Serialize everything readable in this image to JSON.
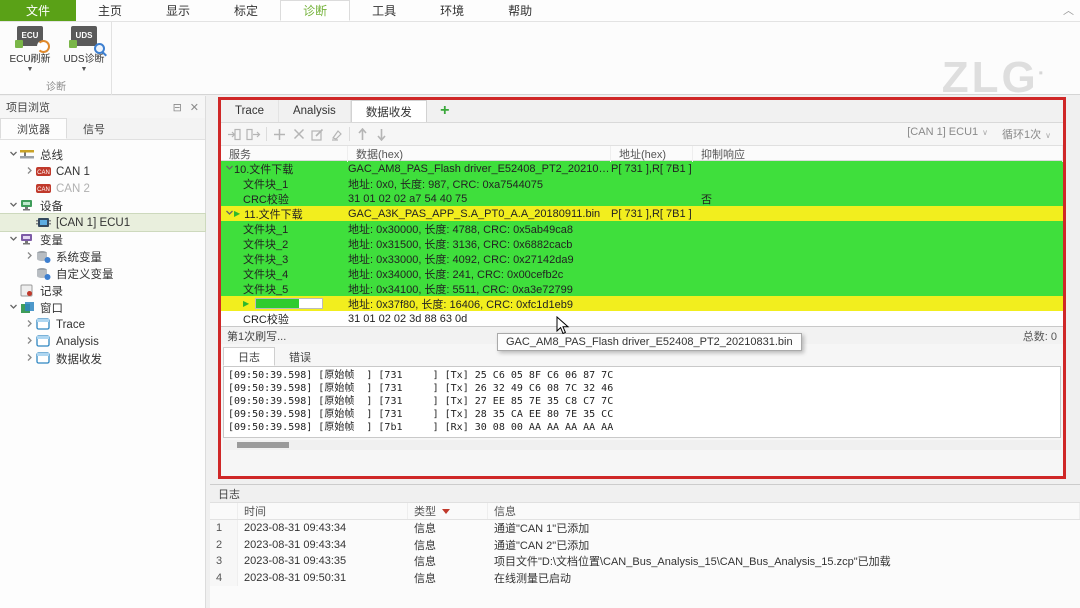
{
  "colors": {
    "row_green": "#3fdf3c",
    "row_yellow": "#f2ee1e",
    "annotation_red": "#cf2727",
    "accent_green": "#5aa117",
    "progress_green": "#2ecc2e"
  },
  "ribbon": {
    "tabs": [
      {
        "label": "文件",
        "accent": true
      },
      {
        "label": "主页"
      },
      {
        "label": "显示"
      },
      {
        "label": "标定"
      },
      {
        "label": "诊断",
        "active": true
      },
      {
        "label": "工具"
      },
      {
        "label": "环境"
      },
      {
        "label": "帮助"
      }
    ],
    "buttons": [
      {
        "label": "ECU刷新",
        "chip": "ECU",
        "overlay": "refresh",
        "caret": "▼"
      },
      {
        "label": "UDS诊断",
        "chip": "UDS",
        "overlay": "search",
        "caret": "▼"
      }
    ],
    "group_label": "诊断",
    "logo_text": "ZLG",
    "collapse_glyph": "︿"
  },
  "sidebar": {
    "title": "项目浏览",
    "pin_glyph": "⊟",
    "close_glyph": "✕",
    "tabs": [
      {
        "label": "浏览器",
        "active": true
      },
      {
        "label": "信号",
        "active": false
      }
    ],
    "tree": [
      {
        "label": "总线",
        "level": 0,
        "chev": "down",
        "icon": "bus"
      },
      {
        "label": "CAN 1",
        "level": 1,
        "chev": "right",
        "icon": "can"
      },
      {
        "label": "CAN 2",
        "level": 1,
        "chev": "",
        "icon": "can",
        "disabled": true
      },
      {
        "label": "设备",
        "level": 0,
        "chev": "down",
        "icon": "device"
      },
      {
        "label": "[CAN 1] ECU1",
        "level": 1,
        "chev": "",
        "icon": "ecu",
        "selected": true
      },
      {
        "label": "变量",
        "level": 0,
        "chev": "down",
        "icon": "variable"
      },
      {
        "label": "系统变量",
        "level": 1,
        "chev": "right",
        "icon": "sysvar"
      },
      {
        "label": "自定义变量",
        "level": 1,
        "chev": "",
        "icon": "uservar"
      },
      {
        "label": "记录",
        "level": 0,
        "chev": "",
        "icon": "record"
      },
      {
        "label": "窗口",
        "level": 0,
        "chev": "down",
        "icon": "winfolder"
      },
      {
        "label": "Trace",
        "level": 1,
        "chev": "right",
        "icon": "win"
      },
      {
        "label": "Analysis",
        "level": 1,
        "chev": "right",
        "icon": "win"
      },
      {
        "label": "数据收发",
        "level": 1,
        "chev": "right",
        "icon": "win"
      }
    ]
  },
  "main": {
    "tabs": [
      {
        "label": "Trace",
        "active": false
      },
      {
        "label": "Analysis",
        "active": false
      },
      {
        "label": "数据收发",
        "active": true
      }
    ],
    "plus_label": "+",
    "toolbar_icons": [
      "import",
      "export",
      "add",
      "delete",
      "edit",
      "clear",
      "up",
      "down"
    ],
    "ecu_selector": "[CAN 1] ECU1",
    "loop_selector": "循环1次",
    "columns": [
      "服务",
      "数据(hex)",
      "地址(hex)",
      "抑制响应"
    ],
    "rows": [
      {
        "service": "10.文件下载",
        "chev": "v",
        "play": false,
        "level": 0,
        "data": "GAC_AM8_PAS_Flash driver_E52408_PT2_202108...",
        "addr": "P[ 731 ],R[ 7B1 ]",
        "suppress": "",
        "bg": "green"
      },
      {
        "service": "文件块_1",
        "chev": "",
        "play": false,
        "level": 1,
        "data": "地址: 0x0, 长度: 987, CRC: 0xa7544075",
        "addr": "",
        "suppress": "",
        "bg": "green"
      },
      {
        "service": "CRC校验",
        "chev": "",
        "play": false,
        "level": 1,
        "data": "31 01 02 02  a7 54 40 75",
        "addr": "",
        "suppress": "否",
        "bg": "green"
      },
      {
        "service": "11.文件下载",
        "chev": "v",
        "play": true,
        "level": 0,
        "data": "GAC_A3K_PAS_APP_S.A_PT0_A.A_20180911.bin",
        "addr": "P[ 731 ],R[ 7B1 ]",
        "suppress": "",
        "bg": "yellow"
      },
      {
        "service": "文件块_1",
        "chev": "",
        "play": false,
        "level": 1,
        "data": "地址: 0x30000, 长度: 4788, CRC: 0x5ab49ca8",
        "addr": "",
        "suppress": "",
        "bg": "green"
      },
      {
        "service": "文件块_2",
        "chev": "",
        "play": false,
        "level": 1,
        "data": "地址: 0x31500, 长度: 3136, CRC: 0x6882cacb",
        "addr": "",
        "suppress": "",
        "bg": "green"
      },
      {
        "service": "文件块_3",
        "chev": "",
        "play": false,
        "level": 1,
        "data": "地址: 0x33000, 长度: 4092, CRC: 0x27142da9",
        "addr": "",
        "suppress": "",
        "bg": "green"
      },
      {
        "service": "文件块_4",
        "chev": "",
        "play": false,
        "level": 1,
        "data": "地址: 0x34000, 长度: 241, CRC: 0x00cefb2c",
        "addr": "",
        "suppress": "",
        "bg": "green"
      },
      {
        "service": "文件块_5",
        "chev": "",
        "play": false,
        "level": 1,
        "data": "地址: 0x34100, 长度: 5511, CRC: 0xa3e72799",
        "addr": "",
        "suppress": "",
        "bg": "green"
      },
      {
        "service": "",
        "chev": "",
        "play": true,
        "level": 1,
        "progress": 65,
        "data": "地址: 0x37f80, 长度: 16406, CRC: 0xfc1d1eb9",
        "addr": "",
        "suppress": "",
        "bg": "yellow"
      },
      {
        "service": "CRC校验",
        "chev": "",
        "play": false,
        "level": 1,
        "data": "31 01 02 02  3d 88 63 0d",
        "addr": "",
        "suppress": "",
        "bg": "white"
      }
    ],
    "status_left": "第1次刷写...",
    "status_right": "总数: 0",
    "tooltip": "GAC_AM8_PAS_Flash driver_E52408_PT2_20210831.bin",
    "log_tabs": [
      {
        "label": "日志",
        "active": true
      },
      {
        "label": "错误",
        "active": false
      }
    ],
    "log_lines": [
      "[09:50:39.598] [原始帧  ] [731     ] [Tx] 25 C6 05 8F C6 06 87 7C",
      "[09:50:39.598] [原始帧  ] [731     ] [Tx] 26 32 49 C6 08 7C 32 46",
      "[09:50:39.598] [原始帧  ] [731     ] [Tx] 27 EE 85 7E 35 C8 C7 7C",
      "[09:50:39.598] [原始帧  ] [731     ] [Tx] 28 35 CA EE 80 7E 35 CC",
      "[09:50:39.598] [原始帧  ] [7b1     ] [Rx] 30 08 00 AA AA AA AA AA"
    ]
  },
  "bottom": {
    "title": "日志",
    "columns": [
      "时间",
      "类型",
      "信息"
    ],
    "rows": [
      {
        "num": "1",
        "time": "2023-08-31 09:43:34",
        "type": "信息",
        "info": "通道\"CAN 1\"已添加"
      },
      {
        "num": "2",
        "time": "2023-08-31 09:43:34",
        "type": "信息",
        "info": "通道\"CAN 2\"已添加"
      },
      {
        "num": "3",
        "time": "2023-08-31 09:43:35",
        "type": "信息",
        "info": "项目文件\"D:\\文档位置\\CAN_Bus_Analysis_15\\CAN_Bus_Analysis_15.zcp\"已加载"
      },
      {
        "num": "4",
        "time": "2023-08-31 09:50:31",
        "type": "信息",
        "info": "在线测量已启动"
      }
    ]
  }
}
